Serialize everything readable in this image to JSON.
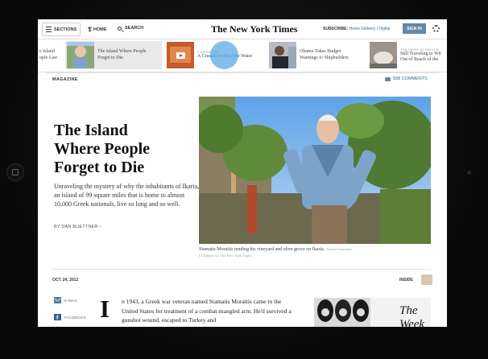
{
  "device": {
    "home_button": "home-button-icon"
  },
  "topbar": {
    "sections_label": "SECTIONS",
    "home_label": "HOME",
    "search_label": "SEARCH",
    "masthead": "The New York Times",
    "subscribe_label": "SUBSCRIBE:",
    "subscribe_options": "Home Delivery | Digital",
    "signin_label": "SIGN IN",
    "accent_color": "#6288a5"
  },
  "carousel": [
    {
      "text_lines": [
        "e Island",
        "ople Law"
      ]
    },
    {
      "text_lines": [
        "The Island Where People",
        "Forget to Die"
      ],
      "active": true
    },
    {
      "kicker": "T MAGAZINE",
      "text_lines": [
        "A Crusade to Find the Water"
      ],
      "video": true
    },
    {
      "text_lines": [
        "Obama Takes Budget",
        "Warnings to Shipbuilders"
      ]
    },
    {
      "kicker": "THE WEEK IN REVIEW",
      "text_lines": [
        "Still Traveling to Wit",
        "Out of Reach of the"
      ]
    }
  ],
  "article": {
    "section": "MAGAZINE",
    "comments": "598 COMMENTS",
    "headline_lines": [
      "The Island",
      "Where People",
      "Forget to Die"
    ],
    "summary": "Unraveling the mystery of why the inhabitants of Ikaria, an island of 99 square miles that is home to almost 10,000 Greek nationals, live so long and so well.",
    "byline": "BY DAN BUETTNER",
    "byline_more": "+",
    "caption": "Stamatis Moraitis tending his vineyard and olive grove on Ikaria.",
    "credit_name": "Andrea Frazzetta/",
    "credit_org": "LUZphoto for The New York Times",
    "date": "OCT. 24, 2012",
    "inside_label": "INSIDE",
    "share": [
      {
        "label": "E-MAIL",
        "icon": "email-icon"
      },
      {
        "label": "FACEBOOK",
        "icon": "facebook-icon"
      }
    ],
    "dropcap": "I",
    "body": "n 1943, a Greek war veteran named Stamatis Moraitis came to the United States for treatment of a combat-mangled arm. He'd survived a gunshot wound, escaped to Turkey and"
  },
  "ad": {
    "headline": "The Week"
  }
}
